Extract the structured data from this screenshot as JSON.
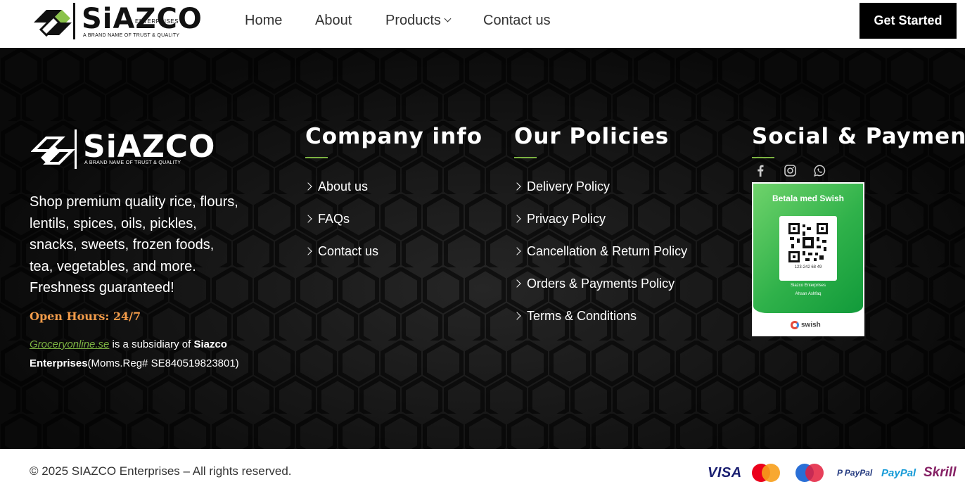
{
  "header": {
    "logo": {
      "brand": "SiAZCO",
      "sub": "ENTERPRISES",
      "tagline": "A BRAND NAME OF TRUST & QUALITY"
    },
    "nav": [
      {
        "label": "Home"
      },
      {
        "label": "About"
      },
      {
        "label": "Products"
      },
      {
        "label": "Contact us"
      }
    ],
    "cta_label": "Get Started"
  },
  "footer": {
    "logo": {
      "brand": "SiAZCO",
      "tagline": "A BRAND NAME OF TRUST & QUALITY"
    },
    "description": "Shop premium quality rice, flours, lentils, spices, oils, pickles, snacks, sweets, frozen foods, tea, vegetables, and more. Freshness guaranteed!",
    "open_hours": "Open Hours: 24/7",
    "subsidiary": {
      "link_text": "Groceryonline.se",
      "middle": " is a subsidiary of ",
      "company": "Siazco Enterprises",
      "reg": "(Moms.Reg# SE840519823801)"
    },
    "company_info": {
      "title": "Company info",
      "links": [
        "About us",
        "FAQs",
        "Contact us"
      ]
    },
    "policies": {
      "title": "Our Policies",
      "links": [
        "Delivery Policy",
        "Privacy Policy",
        "Cancellation & Return Policy",
        "Orders & Payments Policy",
        "Terms & Conditions"
      ]
    },
    "social_payments": {
      "title": "Social & Payments",
      "icons": [
        "facebook-icon",
        "instagram-icon",
        "whatsapp-icon"
      ],
      "swish": {
        "title": "Betala med Swish",
        "number": "123-242 68 49",
        "company": "Siazco Enterprises",
        "owner": "Ahsan Ashfaq",
        "logo_text": "swish"
      }
    }
  },
  "bottom": {
    "copyright": "© 2025 SIAZCO Enterprises – All rights reserved.",
    "payment_methods": {
      "visa": "VISA",
      "mastercard": "MasterCard",
      "maestro": "Maestro",
      "paypal_small": "P PayPal",
      "paypal": "PayPal",
      "skrill": "Skrill"
    }
  }
}
